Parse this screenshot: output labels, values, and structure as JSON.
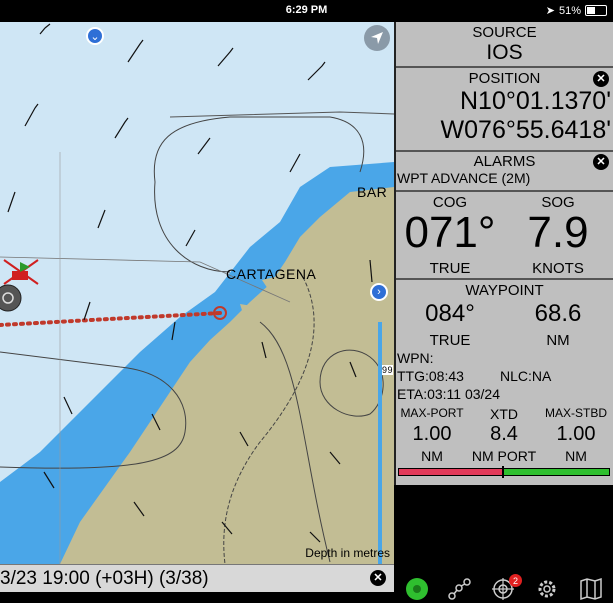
{
  "status": {
    "time": "6:29 PM",
    "battery": "51%",
    "battery_level": 0.51
  },
  "map": {
    "place_label": "CARTAGENA",
    "place_label_2": "BAR",
    "route_label": "99",
    "depth_note": "Depth in metres"
  },
  "track": {
    "text": "3/23 19:00 (+03H) (3/38)"
  },
  "panel": {
    "source": {
      "title": "SOURCE",
      "value": "IOS"
    },
    "position": {
      "title": "POSITION",
      "lat": "N10°01.1370'",
      "lon": "W076°55.6418'"
    },
    "alarms": {
      "title": "ALARMS",
      "value": "WPT ADVANCE (2M)"
    },
    "cogsog": {
      "cog_label": "COG",
      "cog_value": "071°",
      "cog_unit": "TRUE",
      "sog_label": "SOG",
      "sog_value": "7.9",
      "sog_unit": "KNOTS"
    },
    "waypoint": {
      "title": "WAYPOINT",
      "bearing": "084°",
      "bearing_unit": "TRUE",
      "distance": "68.6",
      "distance_unit": "NM",
      "wpn": "WPN:",
      "ttg": "TTG:08:43",
      "nlc": "NLC:NA",
      "eta": "ETA:03:11 03/24"
    },
    "xtd": {
      "max_port_label": "MAX-PORT",
      "xtd_label": "XTD",
      "max_stbd_label": "MAX-STBD",
      "max_port_value": "1.00",
      "xtd_value": "8.4",
      "max_stbd_value": "1.00",
      "max_port_unit": "NM",
      "xtd_unit": "NM PORT",
      "max_stbd_unit": "NM"
    }
  },
  "tabs": {
    "badge": "2"
  },
  "colors": {
    "port": "#e23a5a",
    "stbd": "#2fbf2f",
    "land": "#c2bd94",
    "shallow": "#4aa6e8",
    "deep": "#cfe6f5",
    "route": "#c0392b"
  }
}
